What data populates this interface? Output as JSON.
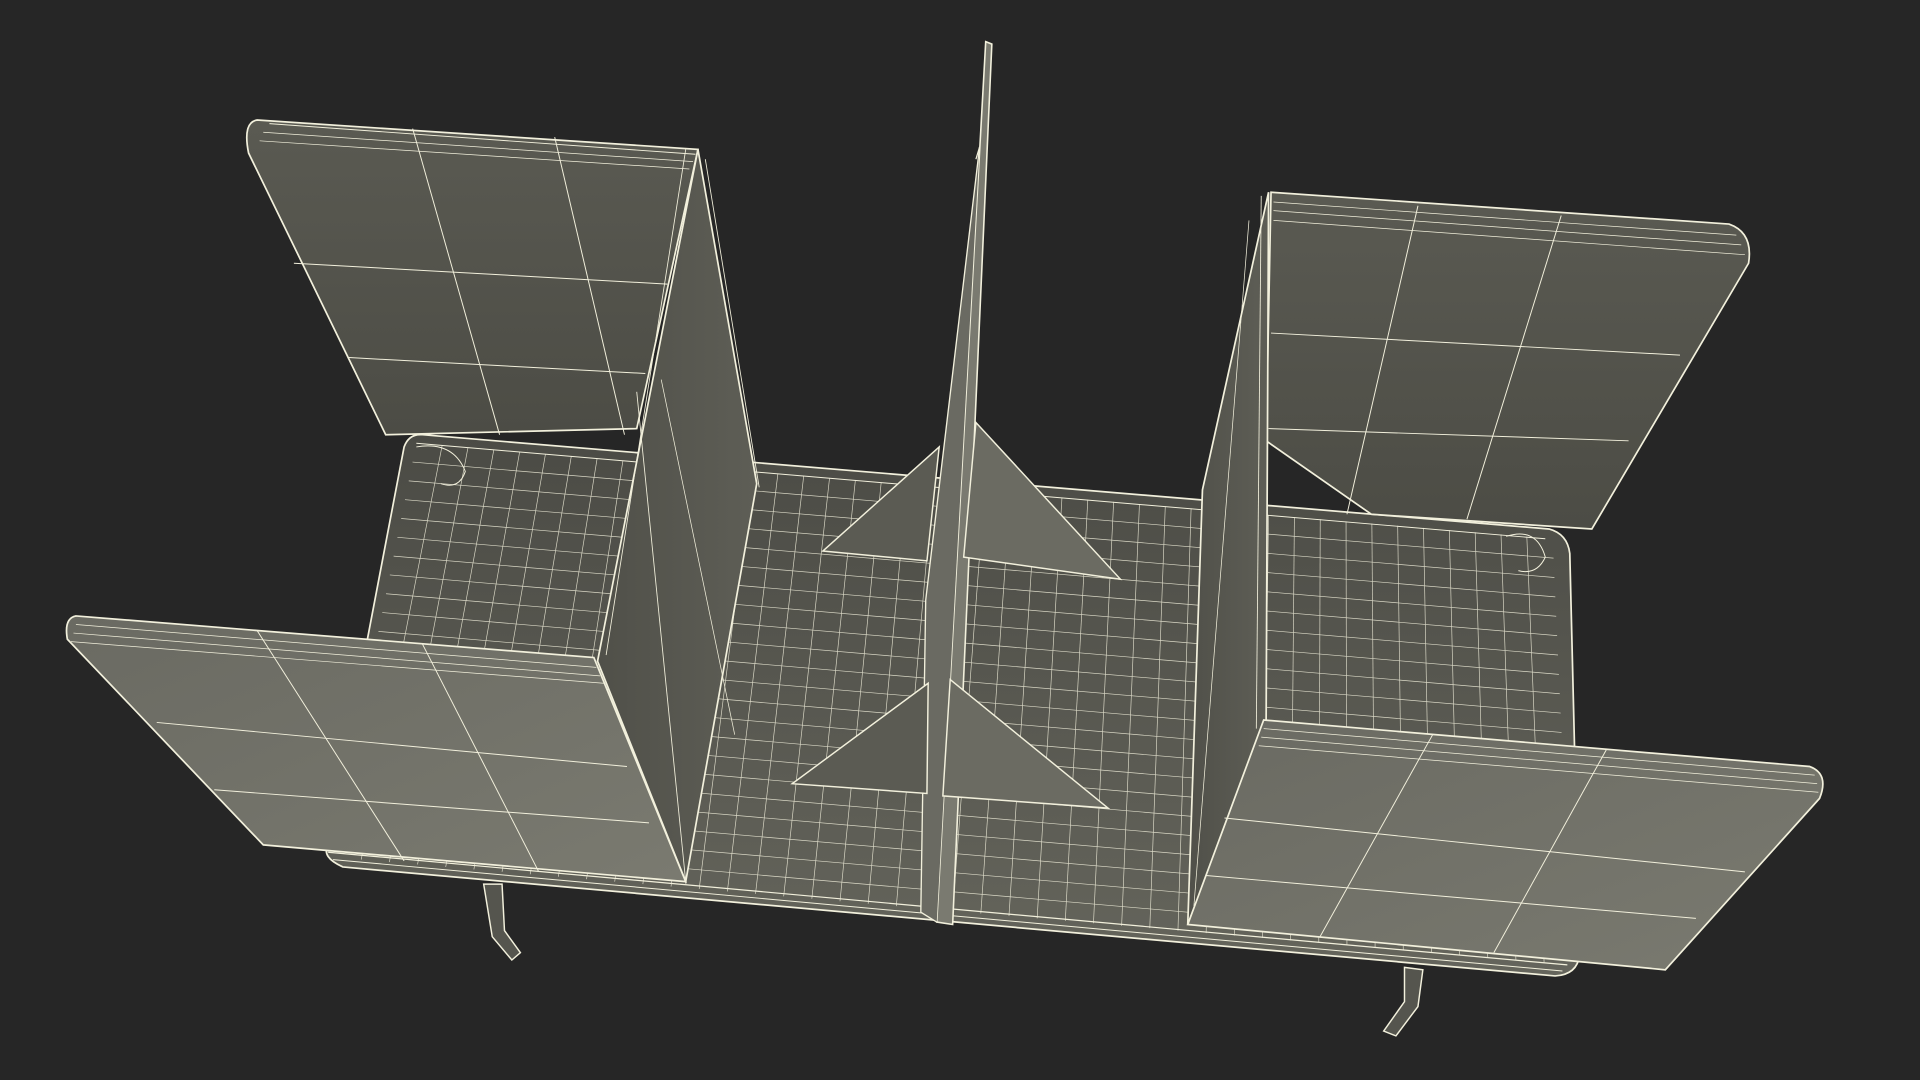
{
  "scene": {
    "subject": "wireframe-render",
    "colors": {
      "background": "#262626",
      "wire": "#f2f0dc",
      "panel_light": "#707068",
      "panel_mid": "#5e5e57",
      "panel_dark": "#4a4a44",
      "floor": "#58584f",
      "floor_dark": "#3f3f39"
    }
  }
}
